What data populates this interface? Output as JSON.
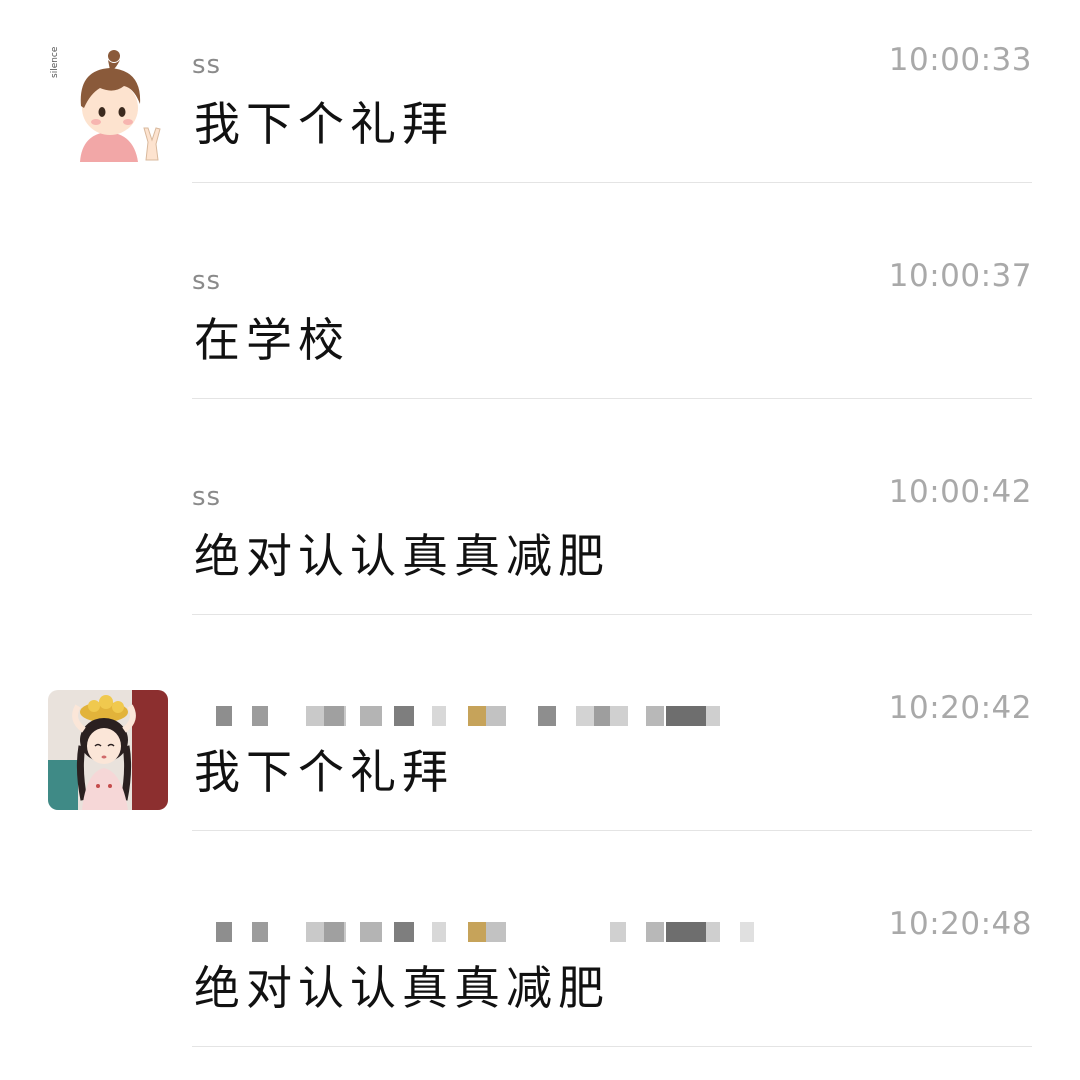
{
  "messages": [
    {
      "sender": "ss",
      "time": "10:00:33",
      "text": "我下个礼拜",
      "avatar": "boy-avatar",
      "avatar_caption": "silence",
      "sender_redacted": false
    },
    {
      "sender": "ss",
      "time": "10:00:37",
      "text": "在学校",
      "avatar": "",
      "sender_redacted": false
    },
    {
      "sender": "ss",
      "time": "10:00:42",
      "text": "绝对认认真真减肥",
      "avatar": "",
      "sender_redacted": false
    },
    {
      "sender": "",
      "time": "10:20:42",
      "text": "我下个礼拜",
      "avatar": "girl-avatar",
      "sender_redacted": true
    },
    {
      "sender": "",
      "time": "10:20:48",
      "text": "绝对认认真真减肥",
      "avatar": "",
      "sender_redacted": true
    }
  ],
  "colors": {
    "background": "#ffffff",
    "sender": "#8a8a8a",
    "time": "#a9a9a9",
    "text": "#111111",
    "divider": "#e4e4e4"
  }
}
